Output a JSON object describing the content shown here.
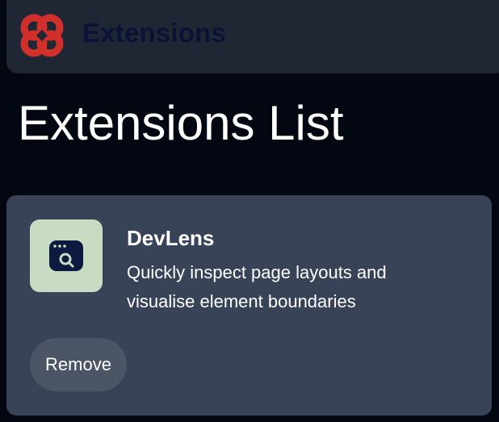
{
  "header": {
    "brand": "Extensions",
    "logo_icon": "clover-logo-icon",
    "logo_color": "#d1302a",
    "brand_color": "#0a1236"
  },
  "main": {
    "title": "Extensions List"
  },
  "extensions": [
    {
      "name": "DevLens",
      "description": "Quickly inspect page layouts and visualise element boundaries",
      "icon": "browser-search-icon",
      "icon_bg": "#c7dcc3",
      "remove_label": "Remove"
    }
  ]
}
